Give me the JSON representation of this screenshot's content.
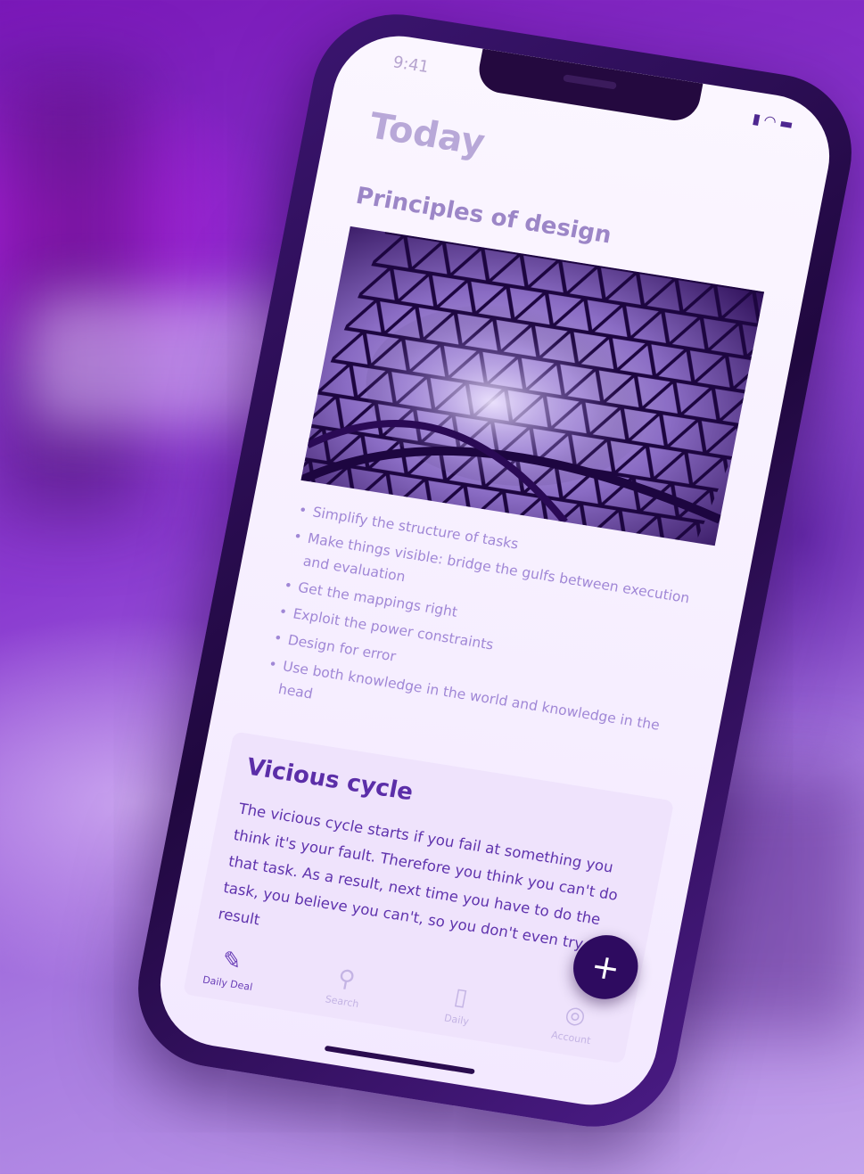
{
  "status_bar": {
    "time": "9:41",
    "icons": "signal-wifi-battery"
  },
  "page": {
    "title": "Today"
  },
  "article": {
    "section_title": "Principles of design",
    "hero_image": "geometric-lattice-architecture",
    "bullets": [
      "Simplify the structure of tasks",
      "Make things visible: bridge the gulfs between execution and evaluation",
      "Get the mappings right",
      "Exploit the power constraints",
      "Design for error",
      "Use both knowledge in the world and knowledge in the head"
    ]
  },
  "card": {
    "title": "Vicious cycle",
    "body": "The vicious cycle starts if you fail at something you think it's your fault. Therefore you think you can't do that task. As a result, next time you have to do the task, you believe you can't, so you don't even try. The result"
  },
  "fab": {
    "label": "+"
  },
  "tabs": [
    {
      "label": "Daily Deal",
      "icon": "lamp-icon",
      "glyph": "✎",
      "active": true
    },
    {
      "label": "Search",
      "icon": "search-icon",
      "glyph": "⚲",
      "active": false
    },
    {
      "label": "Daily",
      "icon": "book-icon",
      "glyph": "▯",
      "active": false
    },
    {
      "label": "Account",
      "icon": "account-icon",
      "glyph": "◎",
      "active": false
    }
  ],
  "colors": {
    "accent": "#2e0b60",
    "background": "#8a3ad0",
    "text": "#5a28a8"
  }
}
